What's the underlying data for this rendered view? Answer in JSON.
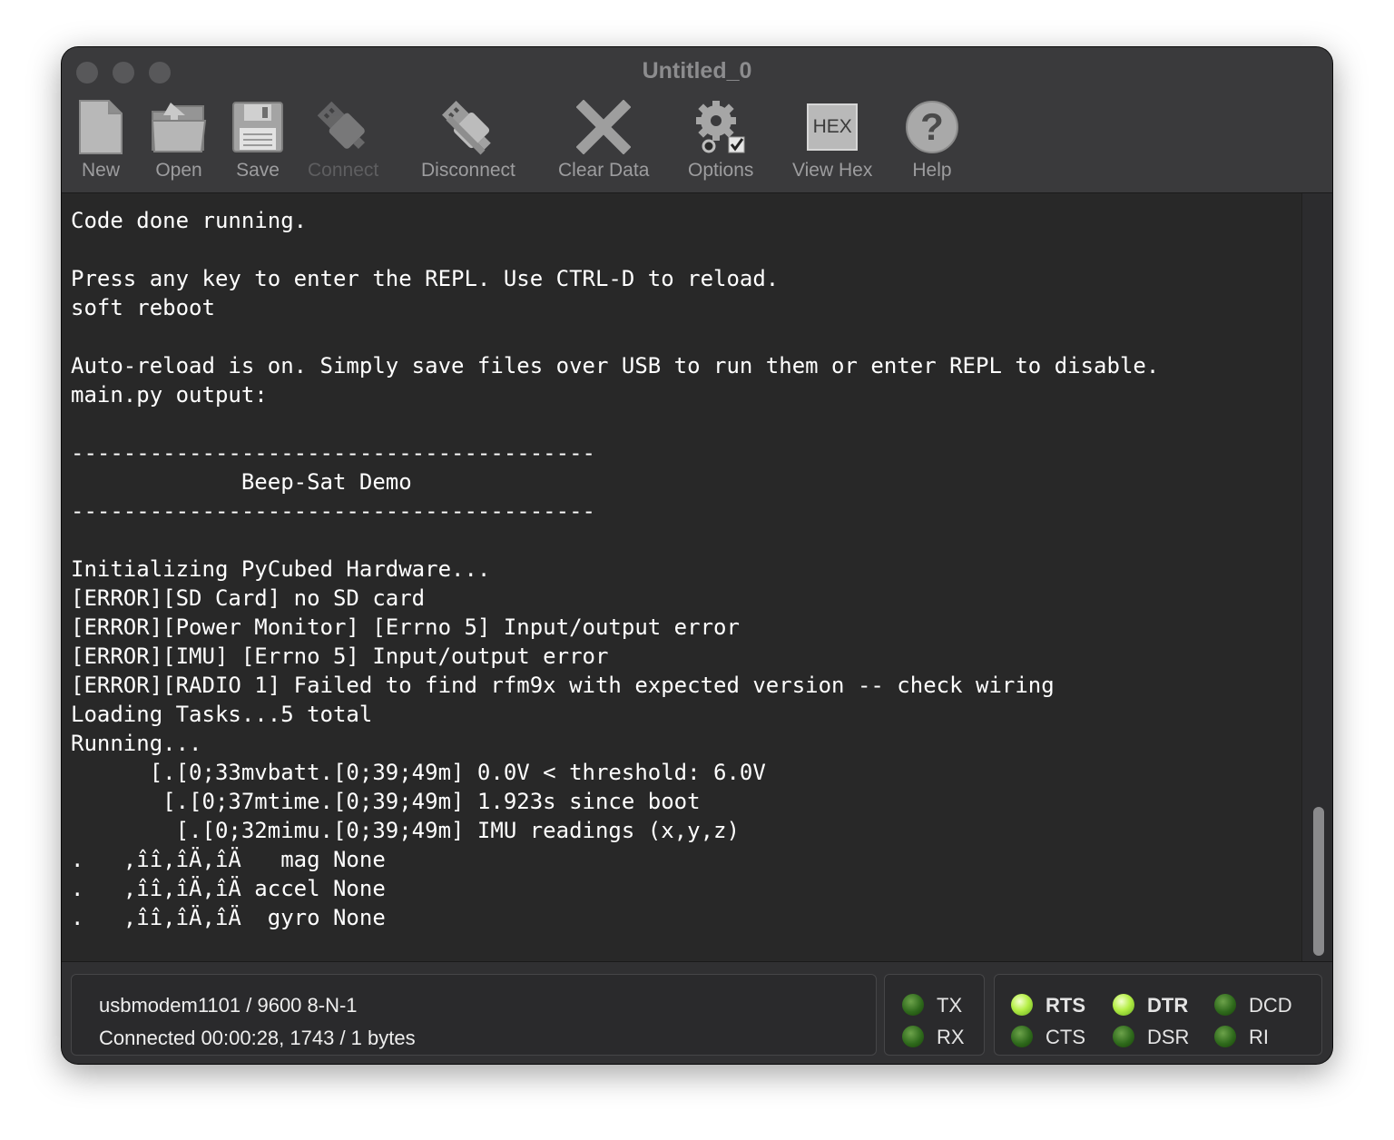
{
  "window": {
    "title": "Untitled_0"
  },
  "toolbar": {
    "new_label": "New",
    "open_label": "Open",
    "save_label": "Save",
    "connect_label": "Connect",
    "disconnect_label": "Disconnect",
    "clear_label": "Clear Data",
    "options_label": "Options",
    "view_hex_label": "View Hex",
    "view_hex_icon_text": "HEX",
    "help_label": "Help",
    "help_icon_text": "?"
  },
  "terminal": {
    "lines": [
      "Code done running.",
      "",
      "Press any key to enter the REPL. Use CTRL-D to reload.",
      "soft reboot",
      "",
      "Auto-reload is on. Simply save files over USB to run them or enter REPL to disable.",
      "main.py output:",
      "",
      "----------------------------------------",
      "             Beep-Sat Demo",
      "----------------------------------------",
      "",
      "Initializing PyCubed Hardware...",
      "[ERROR][SD Card] no SD card",
      "[ERROR][Power Monitor] [Errno 5] Input/output error",
      "[ERROR][IMU] [Errno 5] Input/output error",
      "[ERROR][RADIO 1] Failed to find rfm9x with expected version -- check wiring",
      "Loading Tasks...5 total",
      "Running...",
      "      [.[0;33mvbatt.[0;39;49m] 0.0V < threshold: 6.0V",
      "       [.[0;37mtime.[0;39;49m] 1.923s since boot",
      "        [.[0;32mimu.[0;39;49m] IMU readings (x,y,z)",
      ".   ,îî,îÄ,îÄ   mag None",
      ".   ,îî,îÄ,îÄ accel None",
      ".   ,îî,îÄ,îÄ  gyro None"
    ]
  },
  "status": {
    "port_line": "usbmodem1101 / 9600 8-N-1",
    "connection_line": "Connected 00:00:28, 1743 / 1 bytes"
  },
  "signals": {
    "tx": "TX",
    "rx": "RX",
    "rts": "RTS",
    "cts": "CTS",
    "dtr": "DTR",
    "dsr": "DSR",
    "dcd": "DCD",
    "ri": "RI"
  },
  "led_states": {
    "tx": false,
    "rx": false,
    "rts": true,
    "cts": false,
    "dtr": true,
    "dsr": false,
    "dcd": false,
    "ri": false
  }
}
